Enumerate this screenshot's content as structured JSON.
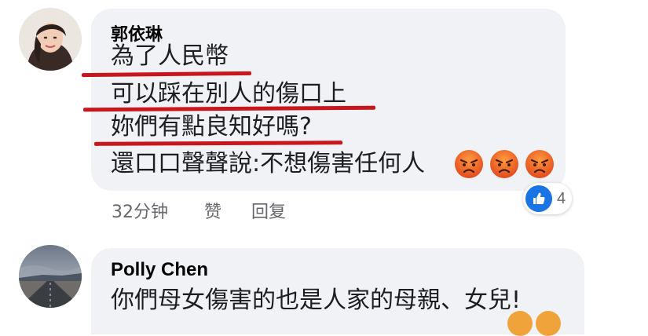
{
  "comments": [
    {
      "author": "郭依琳",
      "lines": [
        "為了人民幣",
        "可以踩在別人的傷口上",
        "妳們有點良知好嗎?",
        "還口口聲聲說:不想傷害任何人"
      ],
      "emojis": [
        "angry-face-icon",
        "angry-face-icon",
        "angry-face-icon"
      ],
      "time": "32分钟",
      "like_label": "赞",
      "reply_label": "回复",
      "reaction_count": "4",
      "underline_color": "#c8161d"
    },
    {
      "author": "Polly Chen",
      "lines": [
        "你們母女傷害的也是人家的母親、女兒!"
      ]
    }
  ],
  "colors": {
    "bubble": "#f0f2f5",
    "like_blue": "#1b74e4",
    "meta_gray": "#65676b"
  }
}
